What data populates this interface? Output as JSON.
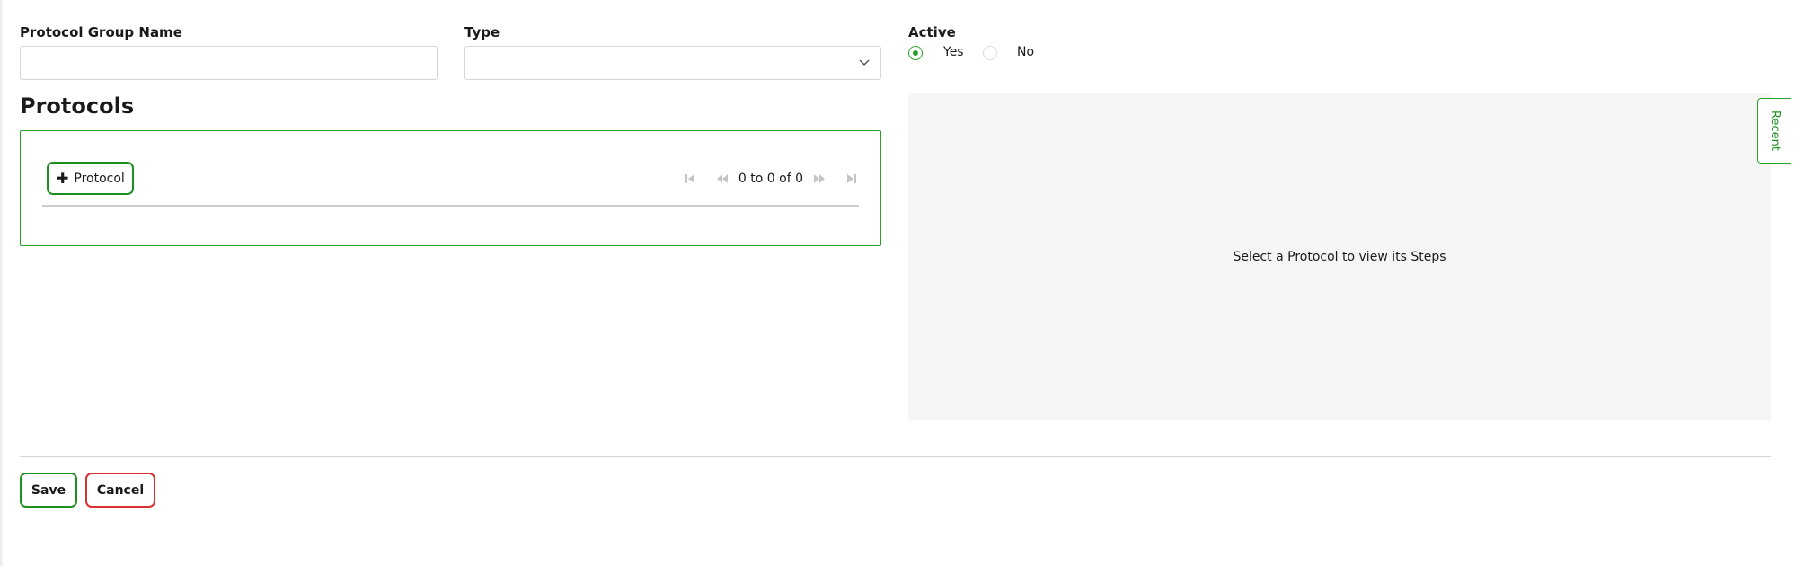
{
  "form": {
    "group_name_label": "Protocol Group Name",
    "group_name_value": "",
    "type_label": "Type",
    "type_value": "",
    "active_label": "Active",
    "active_options": [
      {
        "label": "Yes",
        "selected": true
      },
      {
        "label": "No",
        "selected": false
      }
    ]
  },
  "protocols": {
    "title": "Protocols",
    "add_button_label": "Protocol",
    "pagination_text": "0 to 0 of 0"
  },
  "detail": {
    "empty_message": "Select a Protocol to view its Steps"
  },
  "recent_tab_label": "Recent",
  "actions": {
    "save_label": "Save",
    "cancel_label": "Cancel"
  },
  "colors": {
    "accent_green": "#28a028",
    "cancel_red": "#d93030",
    "panel_gray": "#f5f5f5"
  },
  "icons": {
    "type_dropdown": "chevron-down-icon",
    "add": "plus-icon",
    "first_page": "first-page-icon",
    "prev_page": "previous-page-icon",
    "next_page": "next-page-icon",
    "last_page": "last-page-icon"
  }
}
